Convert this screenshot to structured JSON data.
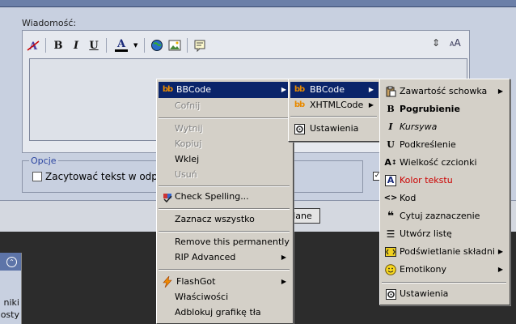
{
  "editor": {
    "message_label": "Wiadomość:",
    "toolbar": {
      "bold": "B",
      "italic": "I",
      "underline": "U",
      "color": "A"
    },
    "options_label": "Opcje",
    "quote_checkbox_label": "Zacytować tekst w odpo",
    "button_label": "lane"
  },
  "side_panel": {
    "line1": "niki",
    "line2": "osty"
  },
  "menu1": {
    "items": [
      {
        "label": "BBCode",
        "state": "highlighted",
        "submenu": true
      },
      {
        "label": "Cofnij",
        "state": "disabled"
      },
      {
        "label": "Wytnij",
        "state": "disabled"
      },
      {
        "label": "Kopiuj",
        "state": "disabled"
      },
      {
        "label": "Wklej",
        "state": "normal"
      },
      {
        "label": "Usuń",
        "state": "disabled"
      },
      {
        "label": "Check Spelling...",
        "state": "normal"
      },
      {
        "label": "Zaznacz wszystko",
        "state": "normal"
      },
      {
        "label": "Remove this permanently",
        "state": "normal"
      },
      {
        "label": "RIP Advanced",
        "state": "normal",
        "submenu": true
      },
      {
        "label": "FlashGot",
        "state": "normal",
        "submenu": true
      },
      {
        "label": "Właściwości",
        "state": "normal"
      },
      {
        "label": "Adblokuj grafikę tła",
        "state": "normal"
      }
    ]
  },
  "menu2": {
    "items": [
      {
        "label": "BBCode",
        "state": "highlighted",
        "submenu": true
      },
      {
        "label": "XHTMLCode",
        "state": "normal",
        "submenu": true
      },
      {
        "label": "Ustawienia",
        "state": "normal"
      }
    ]
  },
  "menu3": {
    "items": [
      {
        "label": "Zawartość schowka",
        "submenu": true
      },
      {
        "label": "Pogrubienie"
      },
      {
        "label": "Kursywa"
      },
      {
        "label": "Podkreślenie"
      },
      {
        "label": "Wielkość czcionki"
      },
      {
        "label": "Kolor tekstu",
        "color": "#cc0000"
      },
      {
        "label": "Kod"
      },
      {
        "label": "Cytuj zaznaczenie"
      },
      {
        "label": "Utwórz listę"
      },
      {
        "label": "Podświetlanie składni",
        "submenu": true
      },
      {
        "label": "Emotikony",
        "submenu": true
      },
      {
        "label": "Ustawienia"
      }
    ]
  },
  "colors": {
    "highlight": "#0a246a",
    "menu_bg": "#d4d0c8",
    "accent_red": "#cc0000"
  }
}
